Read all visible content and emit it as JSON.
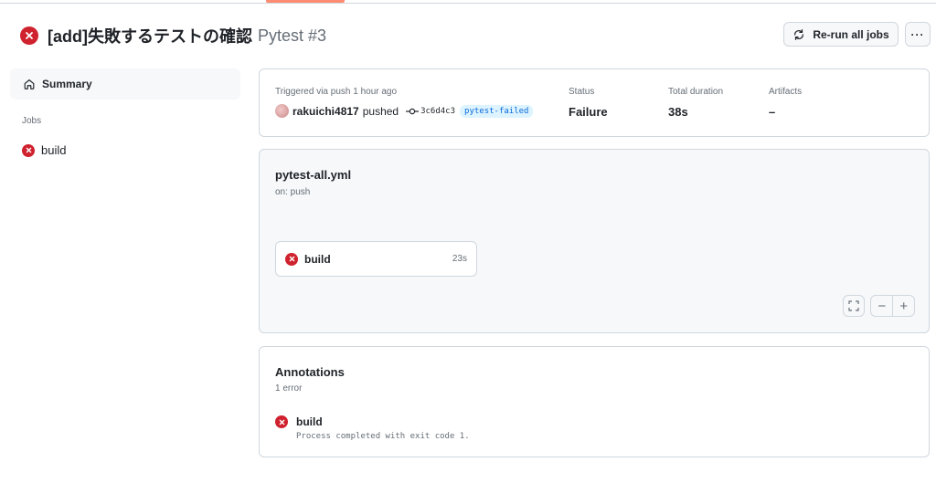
{
  "header": {
    "title": "[add]失敗するテストの確認",
    "subtitle": "Pytest #3",
    "rerun_label": "Re-run all jobs",
    "more_label": "···"
  },
  "sidebar": {
    "summary_label": "Summary",
    "jobs_heading": "Jobs",
    "jobs": [
      {
        "label": "build",
        "status": "failure"
      }
    ]
  },
  "run_info": {
    "trigger_label": "Triggered via push 1 hour ago",
    "user": "rakuichi4817",
    "action": "pushed",
    "commit_sha": "3c6d4c3",
    "branch": "pytest-failed",
    "status_label": "Status",
    "status_value": "Failure",
    "duration_label": "Total duration",
    "duration_value": "38s",
    "artifacts_label": "Artifacts",
    "artifacts_value": "–"
  },
  "workflow": {
    "file": "pytest-all.yml",
    "trigger": "on: push",
    "job": {
      "label": "build",
      "duration": "23s"
    },
    "zoom_out_label": "−",
    "zoom_in_label": "+"
  },
  "annotations": {
    "title": "Annotations",
    "count": "1 error",
    "items": [
      {
        "label": "build",
        "message": "Process completed with exit code 1."
      }
    ]
  },
  "colors": {
    "failure": "#cf222e",
    "accent": "#fd8c73",
    "branch_bg": "#ddf4ff",
    "branch_fg": "#0969da"
  }
}
